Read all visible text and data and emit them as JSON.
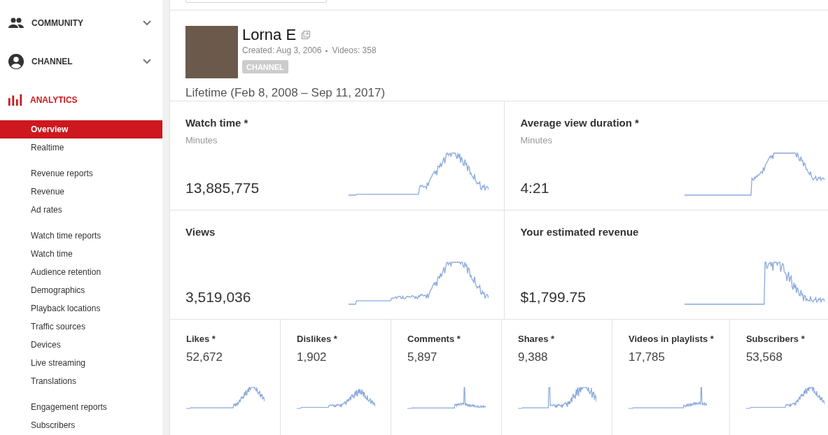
{
  "sidebar": {
    "sections": [
      {
        "label": "COMMUNITY",
        "kind": "community",
        "selected": false,
        "expanded": false
      },
      {
        "label": "CHANNEL",
        "kind": "channel",
        "selected": false,
        "expanded": false
      },
      {
        "label": "ANALYTICS",
        "kind": "analytics",
        "selected": true,
        "expanded": true,
        "groups": [
          {
            "items": [
              {
                "label": "Overview",
                "selected": true
              },
              {
                "label": "Realtime",
                "selected": false
              }
            ]
          },
          {
            "heading": "Revenue reports",
            "items": [
              {
                "label": "Revenue",
                "selected": false
              },
              {
                "label": "Ad rates",
                "selected": false
              }
            ]
          },
          {
            "heading": "Watch time reports",
            "items": [
              {
                "label": "Watch time",
                "selected": false
              },
              {
                "label": "Audience retention",
                "selected": false
              },
              {
                "label": "Demographics",
                "selected": false
              },
              {
                "label": "Playback locations",
                "selected": false
              },
              {
                "label": "Traffic sources",
                "selected": false
              },
              {
                "label": "Devices",
                "selected": false
              },
              {
                "label": "Live streaming",
                "selected": false
              },
              {
                "label": "Translations",
                "selected": false
              }
            ]
          },
          {
            "heading": "Engagement reports",
            "items": [
              {
                "label": "Subscribers",
                "selected": false
              }
            ]
          }
        ]
      }
    ]
  },
  "channel": {
    "name": "Lorna E",
    "created": "Created: Aug 3, 2006",
    "videos": "Videos: 358",
    "badge": "CHANNEL",
    "period": "Lifetime (Feb 8, 2008 – Sep 11, 2017)"
  },
  "main_metrics": [
    {
      "title": "Watch time *",
      "unit": "Minutes",
      "value": "13,885,775"
    },
    {
      "title": "Average view duration *",
      "unit": "Minutes",
      "value": "4:21"
    },
    {
      "title": "Views",
      "value": "3,519,036"
    },
    {
      "title": "Your estimated revenue",
      "value": "$1,799.75"
    }
  ],
  "small_metrics": [
    {
      "title": "Likes *",
      "value": "52,672"
    },
    {
      "title": "Dislikes *",
      "value": "1,902"
    },
    {
      "title": "Comments *",
      "value": "5,897"
    },
    {
      "title": "Shares *",
      "value": "9,388"
    },
    {
      "title": "Videos in playlists *",
      "value": "17,785"
    },
    {
      "title": "Subscribers *",
      "value": "53,568"
    }
  ]
}
